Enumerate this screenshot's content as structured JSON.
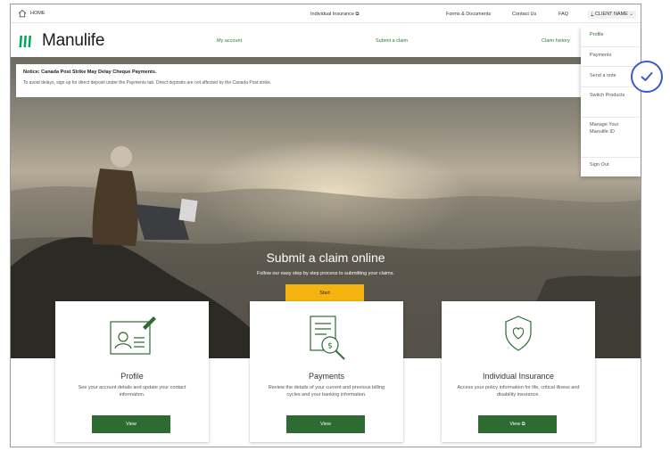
{
  "utility_bar": {
    "home": "HOME",
    "individual_insurance": "Individual Insurance",
    "forms": "Forms & Documents",
    "contact": "Contact Us",
    "faq": "FAQ",
    "client_name": "CLIENT NAME"
  },
  "brand": {
    "name": "Manulife",
    "color": "#00a758"
  },
  "nav": {
    "my_account": "My account",
    "submit_claim": "Submit a claim",
    "claim_history": "Claim history"
  },
  "notice": {
    "title": "Notice: Canada Post Strike May Delay Cheque Payments.",
    "body": "To avoid delays, sign up for direct deposit under the Payments tab. Direct deposits are not affected by the Canada Post strike."
  },
  "hero": {
    "title": "Submit a claim online",
    "subtitle": "Follow our easy step by step process to submitting your claims.",
    "button": "Start"
  },
  "cards": [
    {
      "title": "Profile",
      "description": "See your account details and update your contact information.",
      "button": "View"
    },
    {
      "title": "Payments",
      "description": "Review the details of your current and previous billing cycles and your banking information.",
      "button": "View"
    },
    {
      "title": "Individual Insurance",
      "description": "Access your policy information for life, critical illness and disability insurance.",
      "button": "View"
    }
  ],
  "dropdown": {
    "items": [
      "Profile",
      "Payments",
      "Send a note",
      "Switch Products",
      "Manage Your Manulife ID",
      "Sign Out"
    ]
  },
  "colors": {
    "accent_green": "#2e6b32",
    "cta_yellow": "#f5b30f",
    "check_blue": "#3b5ad0"
  }
}
